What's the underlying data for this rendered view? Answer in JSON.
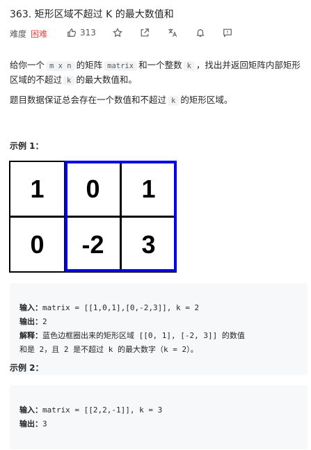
{
  "problem": {
    "title": "363. 矩形区域不超过 K 的最大数值和",
    "difficulty_label": "难度",
    "difficulty_value": "困难",
    "likes": "313",
    "colors": {
      "difficulty": "#ef4743",
      "highlight": "#0000ee"
    }
  },
  "toolbar": {
    "icons": [
      "thumbs-up-icon",
      "star-icon",
      "share-icon",
      "translate-icon",
      "bell-icon",
      "feedback-icon"
    ]
  },
  "description": {
    "p1_parts": [
      "给你一个",
      "m x n",
      "的矩阵",
      "matrix",
      "和一个整数",
      "k",
      "，找出并返回矩阵内部矩形区域的不超过",
      "k",
      "的最大数值和。"
    ],
    "p2_parts": [
      "题目数据保证总会存在一个数值和不超过",
      "k",
      "的矩形区域。"
    ]
  },
  "example1": {
    "heading": "示例 1：",
    "grid": [
      [
        "1",
        "0",
        "1"
      ],
      [
        "0",
        "-2",
        "3"
      ]
    ],
    "input_label": "输入：",
    "input_value": "matrix = [[1,0,1],[0,-2,3]], k = 2",
    "output_label": "输出：",
    "output_value": "2",
    "explain_label": "解释：",
    "explain_line1_text": "蓝色边框圈出来的矩形区域 [[0, 1], [-2, 3]] 的数值",
    "explain_line2_text": "和是 2，且 2 是不超过 k 的最大数字（k = 2）。"
  },
  "example2": {
    "heading": "示例 2：",
    "input_label": "输入：",
    "input_value": "matrix = [[2,2,-1]], k = 3",
    "output_label": "输出：",
    "output_value": "3"
  }
}
